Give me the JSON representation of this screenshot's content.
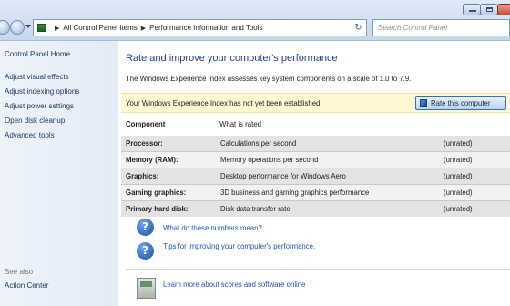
{
  "address_bar": {
    "crumbs": [
      "All Control Panel Items",
      "Performance Information and Tools"
    ],
    "separators": [
      "▶",
      "▶"
    ]
  },
  "search": {
    "placeholder": "Search Control Panel"
  },
  "sidebar": {
    "items": [
      {
        "label": "Control Panel Home"
      },
      {
        "label": "Adjust visual effects"
      },
      {
        "label": "Adjust indexing options"
      },
      {
        "label": "Adjust power settings"
      },
      {
        "label": "Open disk cleanup"
      },
      {
        "label": "Advanced tools"
      }
    ],
    "see_also_label": "See also",
    "see_also_items": [
      {
        "label": "Action Center"
      }
    ]
  },
  "main": {
    "title": "Rate and improve your computer's performance",
    "intro": "The Windows Experience Index assesses key system components on a scale of 1.0 to 7.9.",
    "banner": {
      "text": "Your Windows Experience Index has not yet been established.",
      "button_label": "Rate this computer"
    },
    "table": {
      "headers": {
        "component": "Component",
        "rated": "What is rated"
      },
      "rows": [
        {
          "component": "Processor:",
          "rated": "Calculations per second",
          "score": "(unrated)"
        },
        {
          "component": "Memory (RAM):",
          "rated": "Memory operations per second",
          "score": "(unrated)"
        },
        {
          "component": "Graphics:",
          "rated": "Desktop performance for Windows Aero",
          "score": "(unrated)"
        },
        {
          "component": "Gaming graphics:",
          "rated": "3D business and gaming graphics performance",
          "score": "(unrated)"
        },
        {
          "component": "Primary hard disk:",
          "rated": "Disk data transfer rate",
          "score": "(unrated)"
        }
      ]
    },
    "help_links": [
      {
        "label": "What do these numbers mean?",
        "icon": "question-icon"
      },
      {
        "label": "Tips for improving your computer's performance.",
        "icon": "question-icon"
      },
      {
        "label": "Learn more about scores and software online",
        "icon": "software-box-icon"
      }
    ]
  },
  "colors": {
    "title_blue": "#1e3f91",
    "link_blue": "#1e55b3",
    "banner_bg": "#fdf7d2",
    "sidebar_bg": "#e8eff8"
  }
}
